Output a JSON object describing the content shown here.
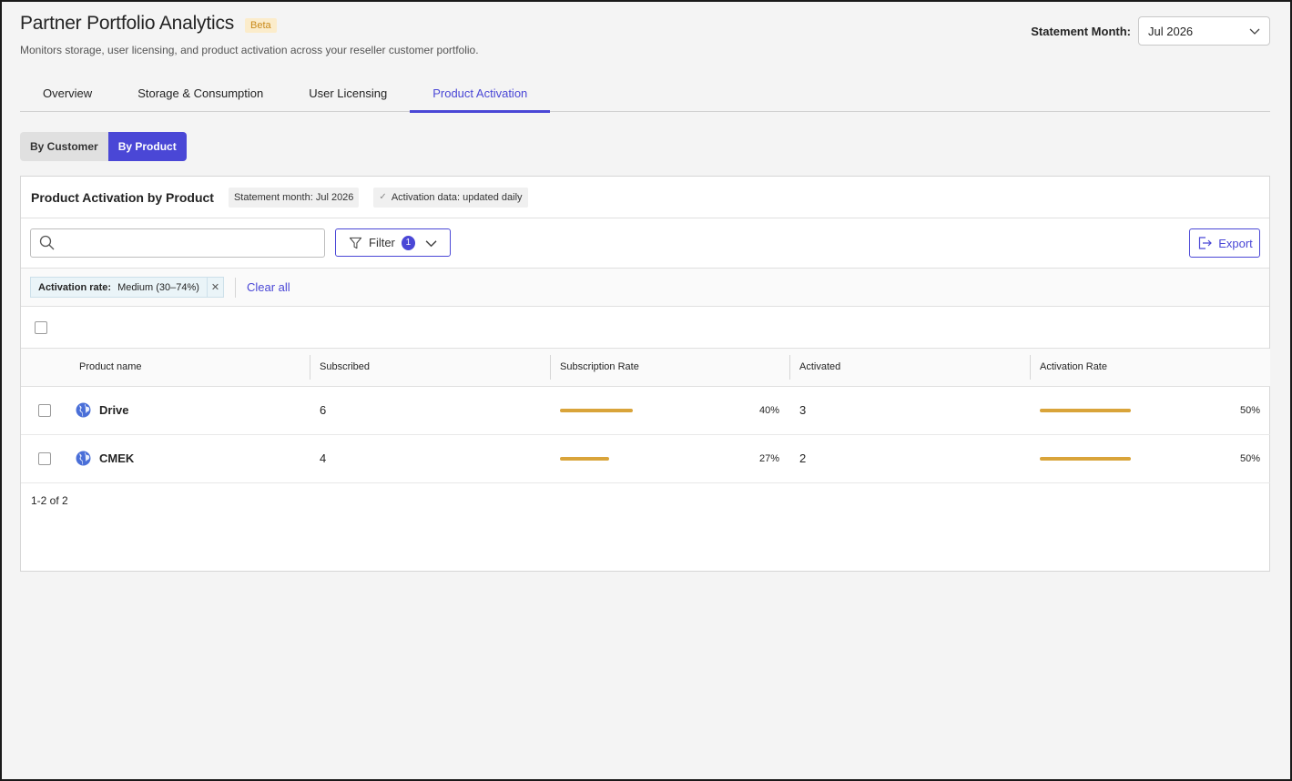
{
  "header": {
    "title": "Partner Portfolio Analytics",
    "badge": "Beta",
    "subtitle": "Monitors storage, user licensing, and product activation across your reseller customer portfolio.",
    "month_label": "Statement Month:",
    "month_value": "Jul 2026"
  },
  "tabs": [
    {
      "label": "Overview",
      "active": false
    },
    {
      "label": "Storage & Consumption",
      "active": false
    },
    {
      "label": "User Licensing",
      "active": false
    },
    {
      "label": "Product Activation",
      "active": true
    }
  ],
  "view_toggle": {
    "by_customer": "By Customer",
    "by_product": "By Product",
    "selected": "By Product"
  },
  "card": {
    "title": "Product Activation by Product",
    "statement_chip": "Statement month: Jul 2026",
    "freshness_chip": "Activation data: updated daily"
  },
  "toolbar": {
    "search_placeholder": "",
    "filter_label": "Filter",
    "filter_count": "1",
    "export_label": "Export"
  },
  "active_filters": [
    {
      "key": "Activation rate:",
      "value": "Medium (30–74%)"
    }
  ],
  "clear_all": "Clear all",
  "table": {
    "columns": [
      "Product name",
      "Subscribed",
      "Subscription Rate",
      "Activated",
      "Activation Rate"
    ],
    "rows": [
      {
        "name": "Drive",
        "subscribed": "6",
        "subscription_rate": 40,
        "subscription_rate_label": "40%",
        "activated": "3",
        "activation_rate": 50,
        "activation_rate_label": "50%"
      },
      {
        "name": "CMEK",
        "subscribed": "4",
        "subscription_rate": 27,
        "subscription_rate_label": "27%",
        "activated": "2",
        "activation_rate": 50,
        "activation_rate_label": "50%"
      }
    ]
  },
  "pager": "1-2 of 2",
  "colors": {
    "accent": "#4a47d6",
    "bar": "#d9a43a",
    "badge_bg": "#fbeccb",
    "badge_text": "#c98a1b"
  }
}
